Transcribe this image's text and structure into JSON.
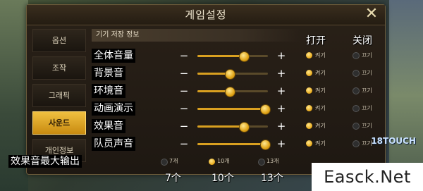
{
  "window": {
    "title": "게임설정",
    "close_icon": "close-x-icon"
  },
  "sidebar": {
    "items": [
      {
        "label": "옵션",
        "active": false
      },
      {
        "label": "조작",
        "active": false
      },
      {
        "label": "그래픽",
        "active": false
      },
      {
        "label": "사운드",
        "active": true
      },
      {
        "label": "개인정보",
        "active": false
      }
    ]
  },
  "section": {
    "header": "기기 저장 정보"
  },
  "columns": {
    "on_label": "打开",
    "off_label": "关闭"
  },
  "rows": [
    {
      "label": "全体音量",
      "level": 0.65,
      "on_text": "켜기",
      "off_text": "끄기",
      "selected": "on"
    },
    {
      "label": "背景音",
      "level": 0.45,
      "on_text": "켜기",
      "off_text": "끄기",
      "selected": "on"
    },
    {
      "label": "环境音",
      "level": 0.45,
      "on_text": "켜기",
      "off_text": "끄기",
      "selected": "on"
    },
    {
      "label": "动画演示",
      "level": 0.95,
      "on_text": "켜기",
      "off_text": "끄기",
      "selected": "on"
    },
    {
      "label": "效果音",
      "level": 0.65,
      "on_text": "켜기",
      "off_text": "끄기",
      "selected": "on"
    },
    {
      "label": "队员声音",
      "level": 0.95,
      "on_text": "켜기",
      "off_text": "끄기",
      "selected": "on"
    }
  ],
  "max_output": {
    "label": "效果音最大输出",
    "options": [
      {
        "label": "7개",
        "caption": "7个",
        "selected": false
      },
      {
        "label": "10개",
        "caption": "10个",
        "selected": true
      },
      {
        "label": "13개",
        "caption": "13个",
        "selected": false
      }
    ]
  },
  "controls": {
    "minus": "−",
    "plus": "+"
  },
  "overlay": {
    "watermark": "Easck.Net",
    "badge": "18TOUCH"
  },
  "colors": {
    "accent": "#e0a418",
    "active_tab": "#f0c040"
  }
}
